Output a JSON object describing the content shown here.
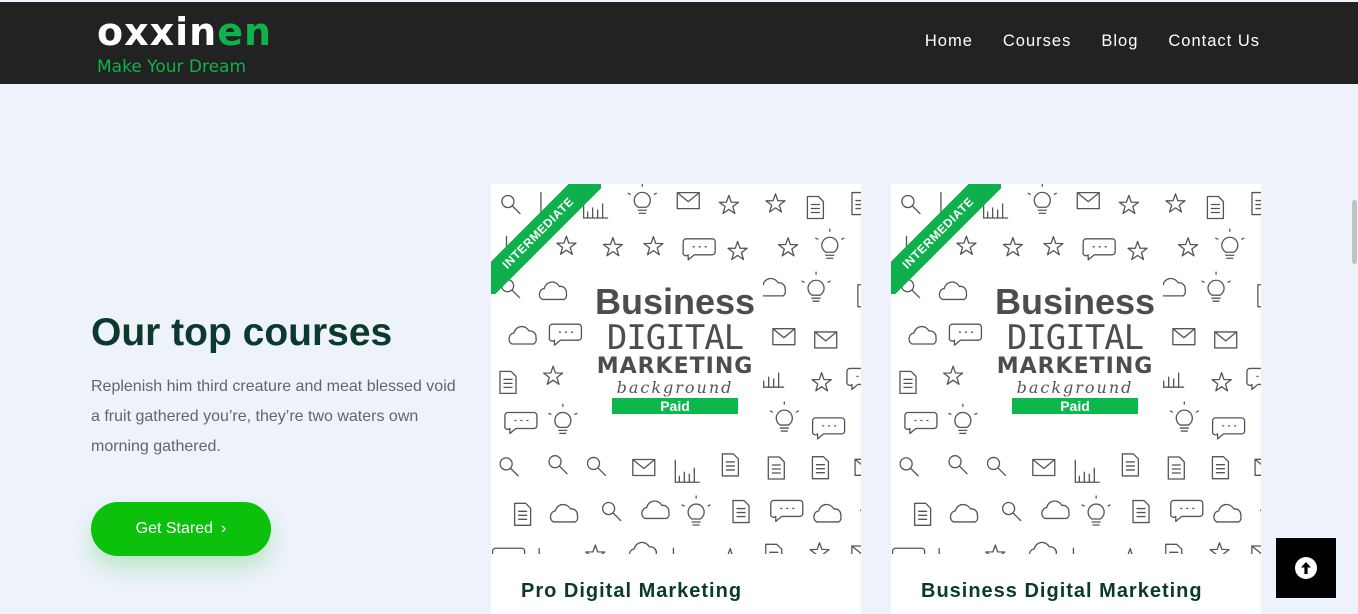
{
  "brand": {
    "logo_white": "oxxin",
    "logo_green": "en",
    "tagline": "Make Your Dream",
    "accent": "#0fb24b"
  },
  "nav": {
    "items": [
      "Home",
      "Courses",
      "Blog",
      "Contact Us"
    ]
  },
  "hero": {
    "title": "Our top courses",
    "description": "Replenish him third creature and meat blessed void a fruit gathered you’re, they’re two waters own morning gathered.",
    "cta_label": "Get Stared",
    "cta_color": "#0cc10c"
  },
  "cards": [
    {
      "badge": "INTERMEDIATE",
      "image": {
        "business": "Business",
        "digital": "DIGITAL",
        "marketing": "MARKETING",
        "background": "background",
        "paid": "Paid"
      },
      "title": "Pro Digital Marketing"
    },
    {
      "badge": "INTERMEDIATE",
      "image": {
        "business": "Business",
        "digital": "DIGITAL",
        "marketing": "MARKETING",
        "background": "background",
        "paid": "Paid"
      },
      "title": "Business Digital Marketing"
    }
  ],
  "icons": {
    "back_to_top": "arrow-up-circle-icon",
    "cta": "chevron-right-icon"
  }
}
